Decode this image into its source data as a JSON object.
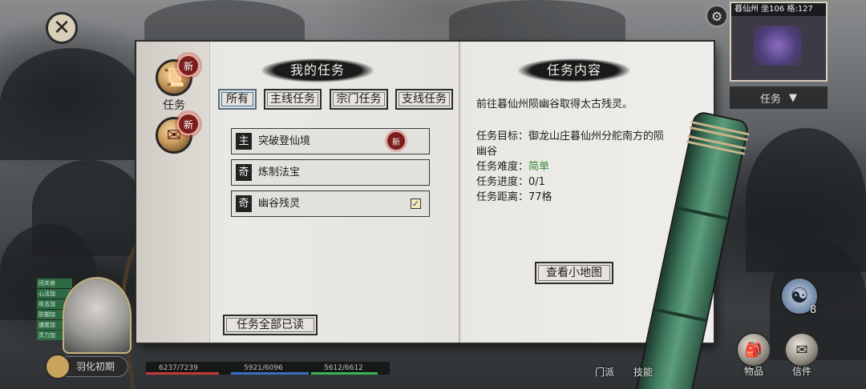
{
  "minimap": {
    "title": "暮仙州 坐106 格:127",
    "mission_tab": "任务",
    "mission_tab_arrow": "▼"
  },
  "side": {
    "tasks_label": "任务",
    "new_badge": "新"
  },
  "left_page": {
    "title": "我的任务",
    "filters": [
      "所有",
      "主线任务",
      "宗门任务",
      "支线任务"
    ],
    "quests": [
      {
        "tag": "主",
        "name": "突破登仙境",
        "badge": "新",
        "checked": false
      },
      {
        "tag": "奇",
        "name": "炼制法宝",
        "badge": "",
        "checked": false
      },
      {
        "tag": "奇",
        "name": "幽谷残灵",
        "badge": "",
        "checked": true
      }
    ],
    "read_all_button": "任务全部已读"
  },
  "right_page": {
    "title": "任务内容",
    "description": "前往暮仙州陨幽谷取得太古残灵。",
    "goal_line1": "任务目标：御龙山庄暮仙州分舵南方的陨",
    "goal_line2": "幽谷",
    "difficulty_label": "任务难度：",
    "difficulty_value": "简单",
    "progress": "任务进度：0/1",
    "distance": "任务距离：77格",
    "view_minimap_button": "查看小地图"
  },
  "hero": {
    "name": "羽化初期",
    "status_pills": [
      "闭关修",
      "心法加",
      "攻击加",
      "防御加",
      "速度加",
      "灵力加"
    ],
    "stats": [
      {
        "label": "6237/7239",
        "color": "#c23a3a",
        "fraction": 0.86
      },
      {
        "label": "5921/6096",
        "color": "#3a6cc2",
        "fraction": 0.97
      },
      {
        "label": "5612/6612",
        "color": "#3ab25a",
        "fraction": 0.85
      }
    ]
  },
  "bottom_right": {
    "taiji_count": "8",
    "buttons": [
      "物品",
      "信件"
    ],
    "extra_labels": [
      "门派",
      "技能"
    ]
  },
  "colors": {
    "accent_green": "#3c8a3a",
    "badge_red": "#7a1f1c"
  }
}
